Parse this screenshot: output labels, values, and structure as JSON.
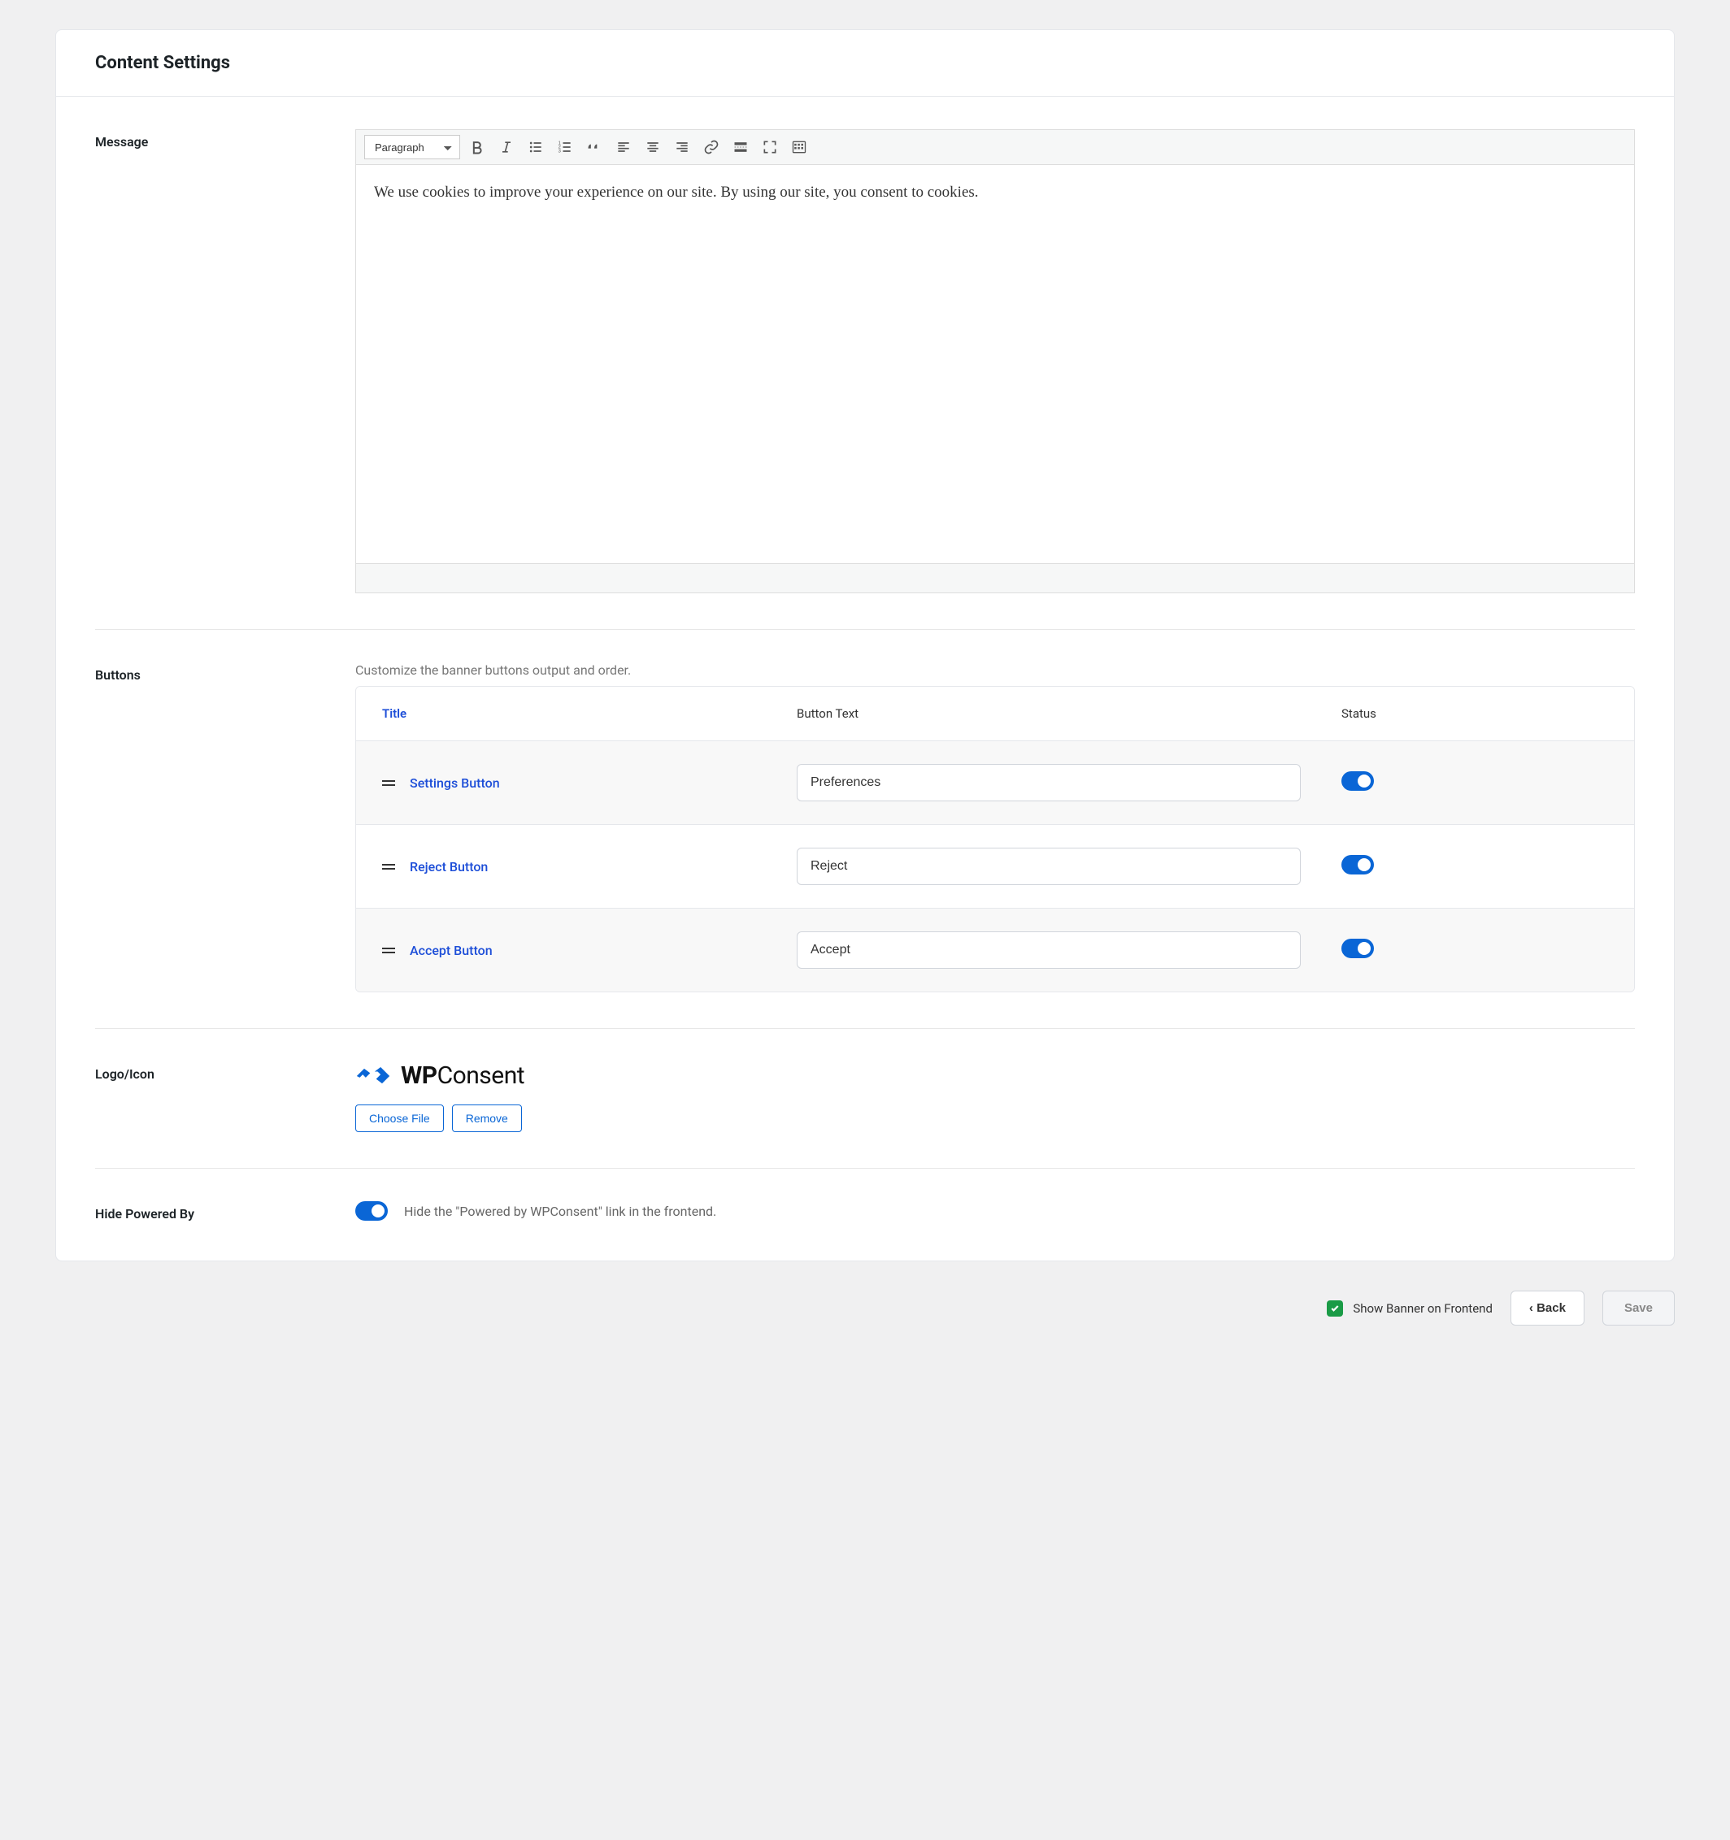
{
  "header": {
    "title": "Content Settings"
  },
  "message": {
    "label": "Message",
    "format_selector": "Paragraph",
    "content": "We use cookies to improve your experience on our site. By using our site, you consent to cookies."
  },
  "buttons": {
    "label": "Buttons",
    "helper": "Customize the banner buttons output and order.",
    "columns": {
      "title": "Title",
      "text": "Button Text",
      "status": "Status"
    },
    "rows": [
      {
        "title": "Settings Button",
        "text": "Preferences",
        "status": true
      },
      {
        "title": "Reject Button",
        "text": "Reject",
        "status": true
      },
      {
        "title": "Accept Button",
        "text": "Accept",
        "status": true
      }
    ]
  },
  "logo": {
    "label": "Logo/Icon",
    "brand_prefix": "WP",
    "brand_suffix": "Consent",
    "choose_file": "Choose File",
    "remove": "Remove"
  },
  "hide_powered": {
    "label": "Hide Powered By",
    "enabled": true,
    "desc": "Hide the \"Powered by WPConsent\" link in the frontend."
  },
  "footer": {
    "show_banner_label": "Show Banner on Frontend",
    "show_banner_checked": true,
    "back": "Back",
    "save": "Save"
  }
}
